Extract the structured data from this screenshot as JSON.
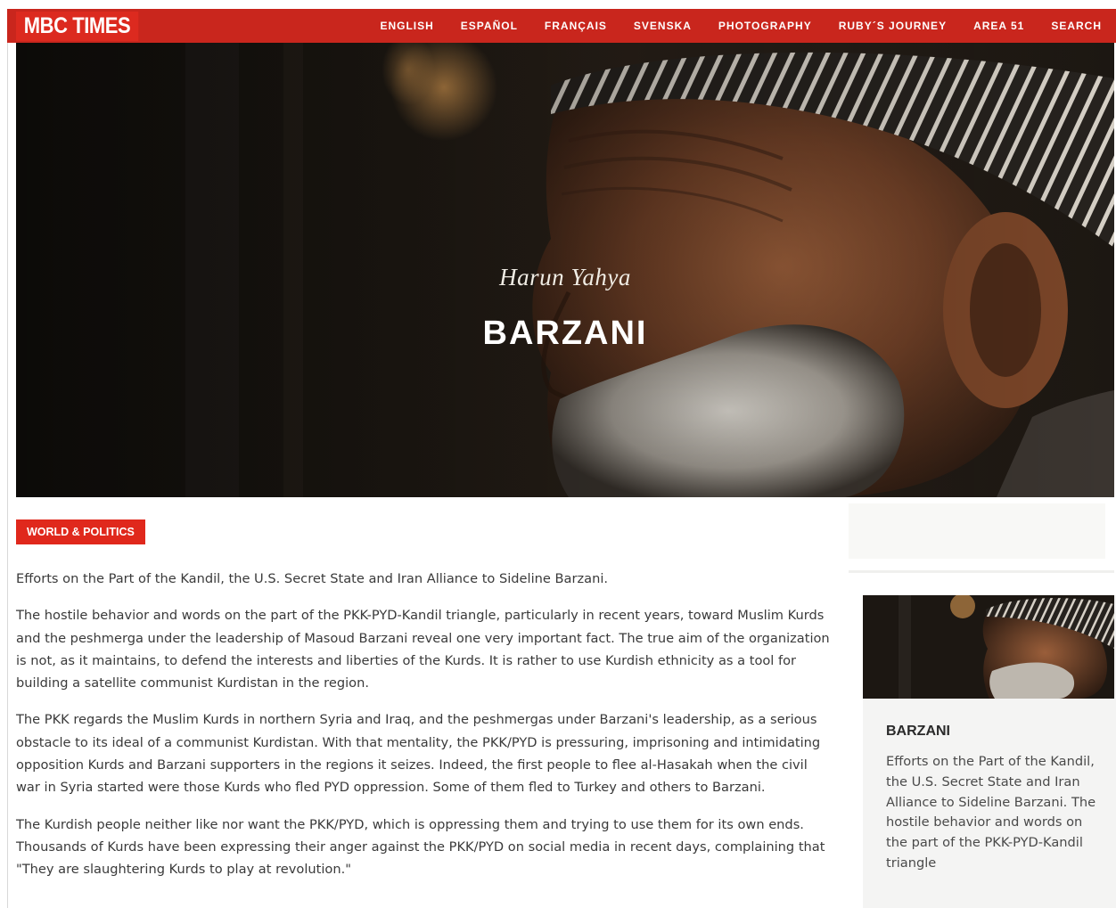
{
  "brand": {
    "logo": "MBC TIMES",
    "accent": "#e0281c",
    "bar": "#c9261d"
  },
  "nav": {
    "items": [
      {
        "label": "ENGLISH"
      },
      {
        "label": "ESPAÑOL"
      },
      {
        "label": "FRANÇAIS"
      },
      {
        "label": "SVENSKA"
      },
      {
        "label": "PHOTOGRAPHY"
      },
      {
        "label": "RUBY´S JOURNEY"
      },
      {
        "label": "AREA 51"
      },
      {
        "label": "SEARCH"
      }
    ]
  },
  "hero": {
    "author": "Harun Yahya",
    "title": "BARZANI",
    "image": "portrait-of-elderly-man-in-turban"
  },
  "article": {
    "category": "WORLD & POLITICS",
    "paragraphs": [
      "Efforts on the Part of the Kandil, the U.S. Secret State and Iran Alliance to Sideline Barzani.",
      "The hostile behavior and words on the part of the PKK-PYD-Kandil triangle, particularly in recent years, toward Muslim Kurds and the peshmerga under the leadership of Masoud Barzani reveal one very important fact. The true aim of the organization is not, as it maintains, to defend the interests and liberties of the Kurds. It is rather to use Kurdish ethnicity as a tool for building a satellite communist Kurdistan in the region.",
      "The PKK regards the Muslim Kurds in northern Syria and Iraq, and the peshmergas under Barzani's leadership, as a serious obstacle to its ideal of a communist Kurdistan. With that mentality, the PKK/PYD is pressuring, imprisoning and intimidating opposition Kurds and Barzani supporters in the regions it seizes. Indeed, the first people to flee al-Hasakah when the civil war in Syria started were those Kurds who fled PYD oppression. Some of them fled to Turkey and others to Barzani.",
      "The Kurdish people neither like nor want the PKK/PYD, which is oppressing them and trying to use them for its own ends. Thousands of Kurds have been expressing their anger against the PKK/PYD on social media in recent days, complaining that \"They are slaughtering Kurds to play at revolution.\""
    ]
  },
  "sidebar": {
    "card": {
      "title": "BARZANI",
      "excerpt": "Efforts on the Part of the Kandil, the U.S. Secret State and Iran Alliance to Sideline Barzani. The hostile behavior and words on the part of the PKK-PYD-Kandil triangle"
    }
  }
}
